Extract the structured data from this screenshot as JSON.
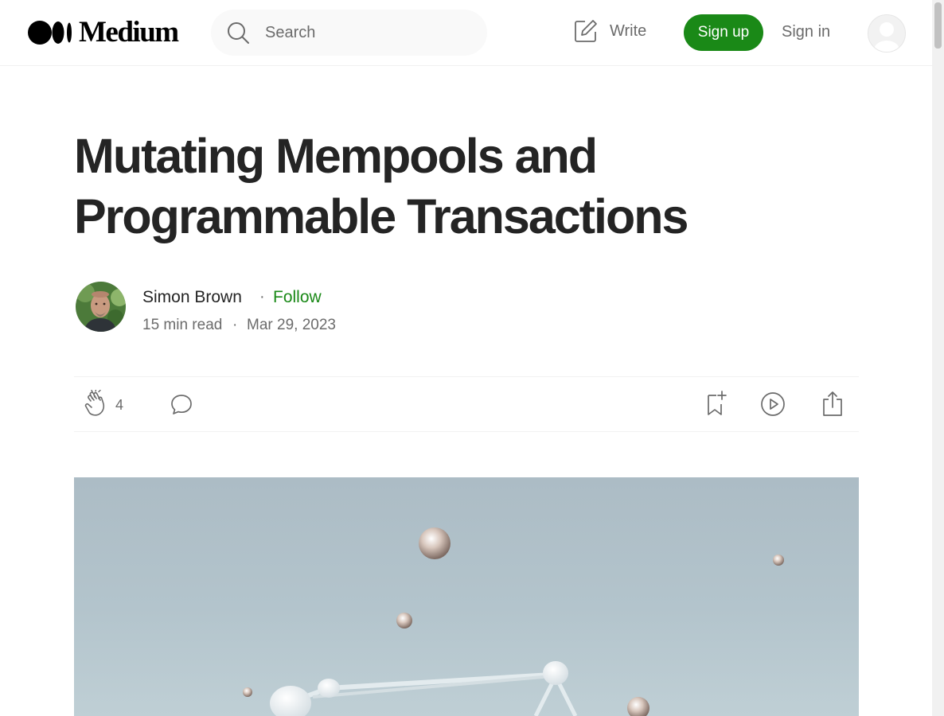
{
  "nav": {
    "logo_text": "Medium",
    "search_placeholder": "Search",
    "write_label": "Write",
    "signup_label": "Sign up",
    "signin_label": "Sign in"
  },
  "article": {
    "title": "Mutating Mempools and Programmable Transactions",
    "author_name": "Simon Brown",
    "separator": "·",
    "follow_label": "Follow",
    "read_time": "15 min read",
    "date": "Mar 29, 2023"
  },
  "actions": {
    "clap_count": "4"
  },
  "icons": {
    "logo": "medium-logo",
    "search": "search-icon",
    "write": "write-icon",
    "clap": "clap-icon",
    "comment": "comment-icon",
    "bookmark": "bookmark-add-icon",
    "listen": "play-icon",
    "share": "share-icon"
  },
  "colors": {
    "brand_green": "#1a8917",
    "text_primary": "#242424",
    "text_secondary": "#6b6b6b"
  }
}
